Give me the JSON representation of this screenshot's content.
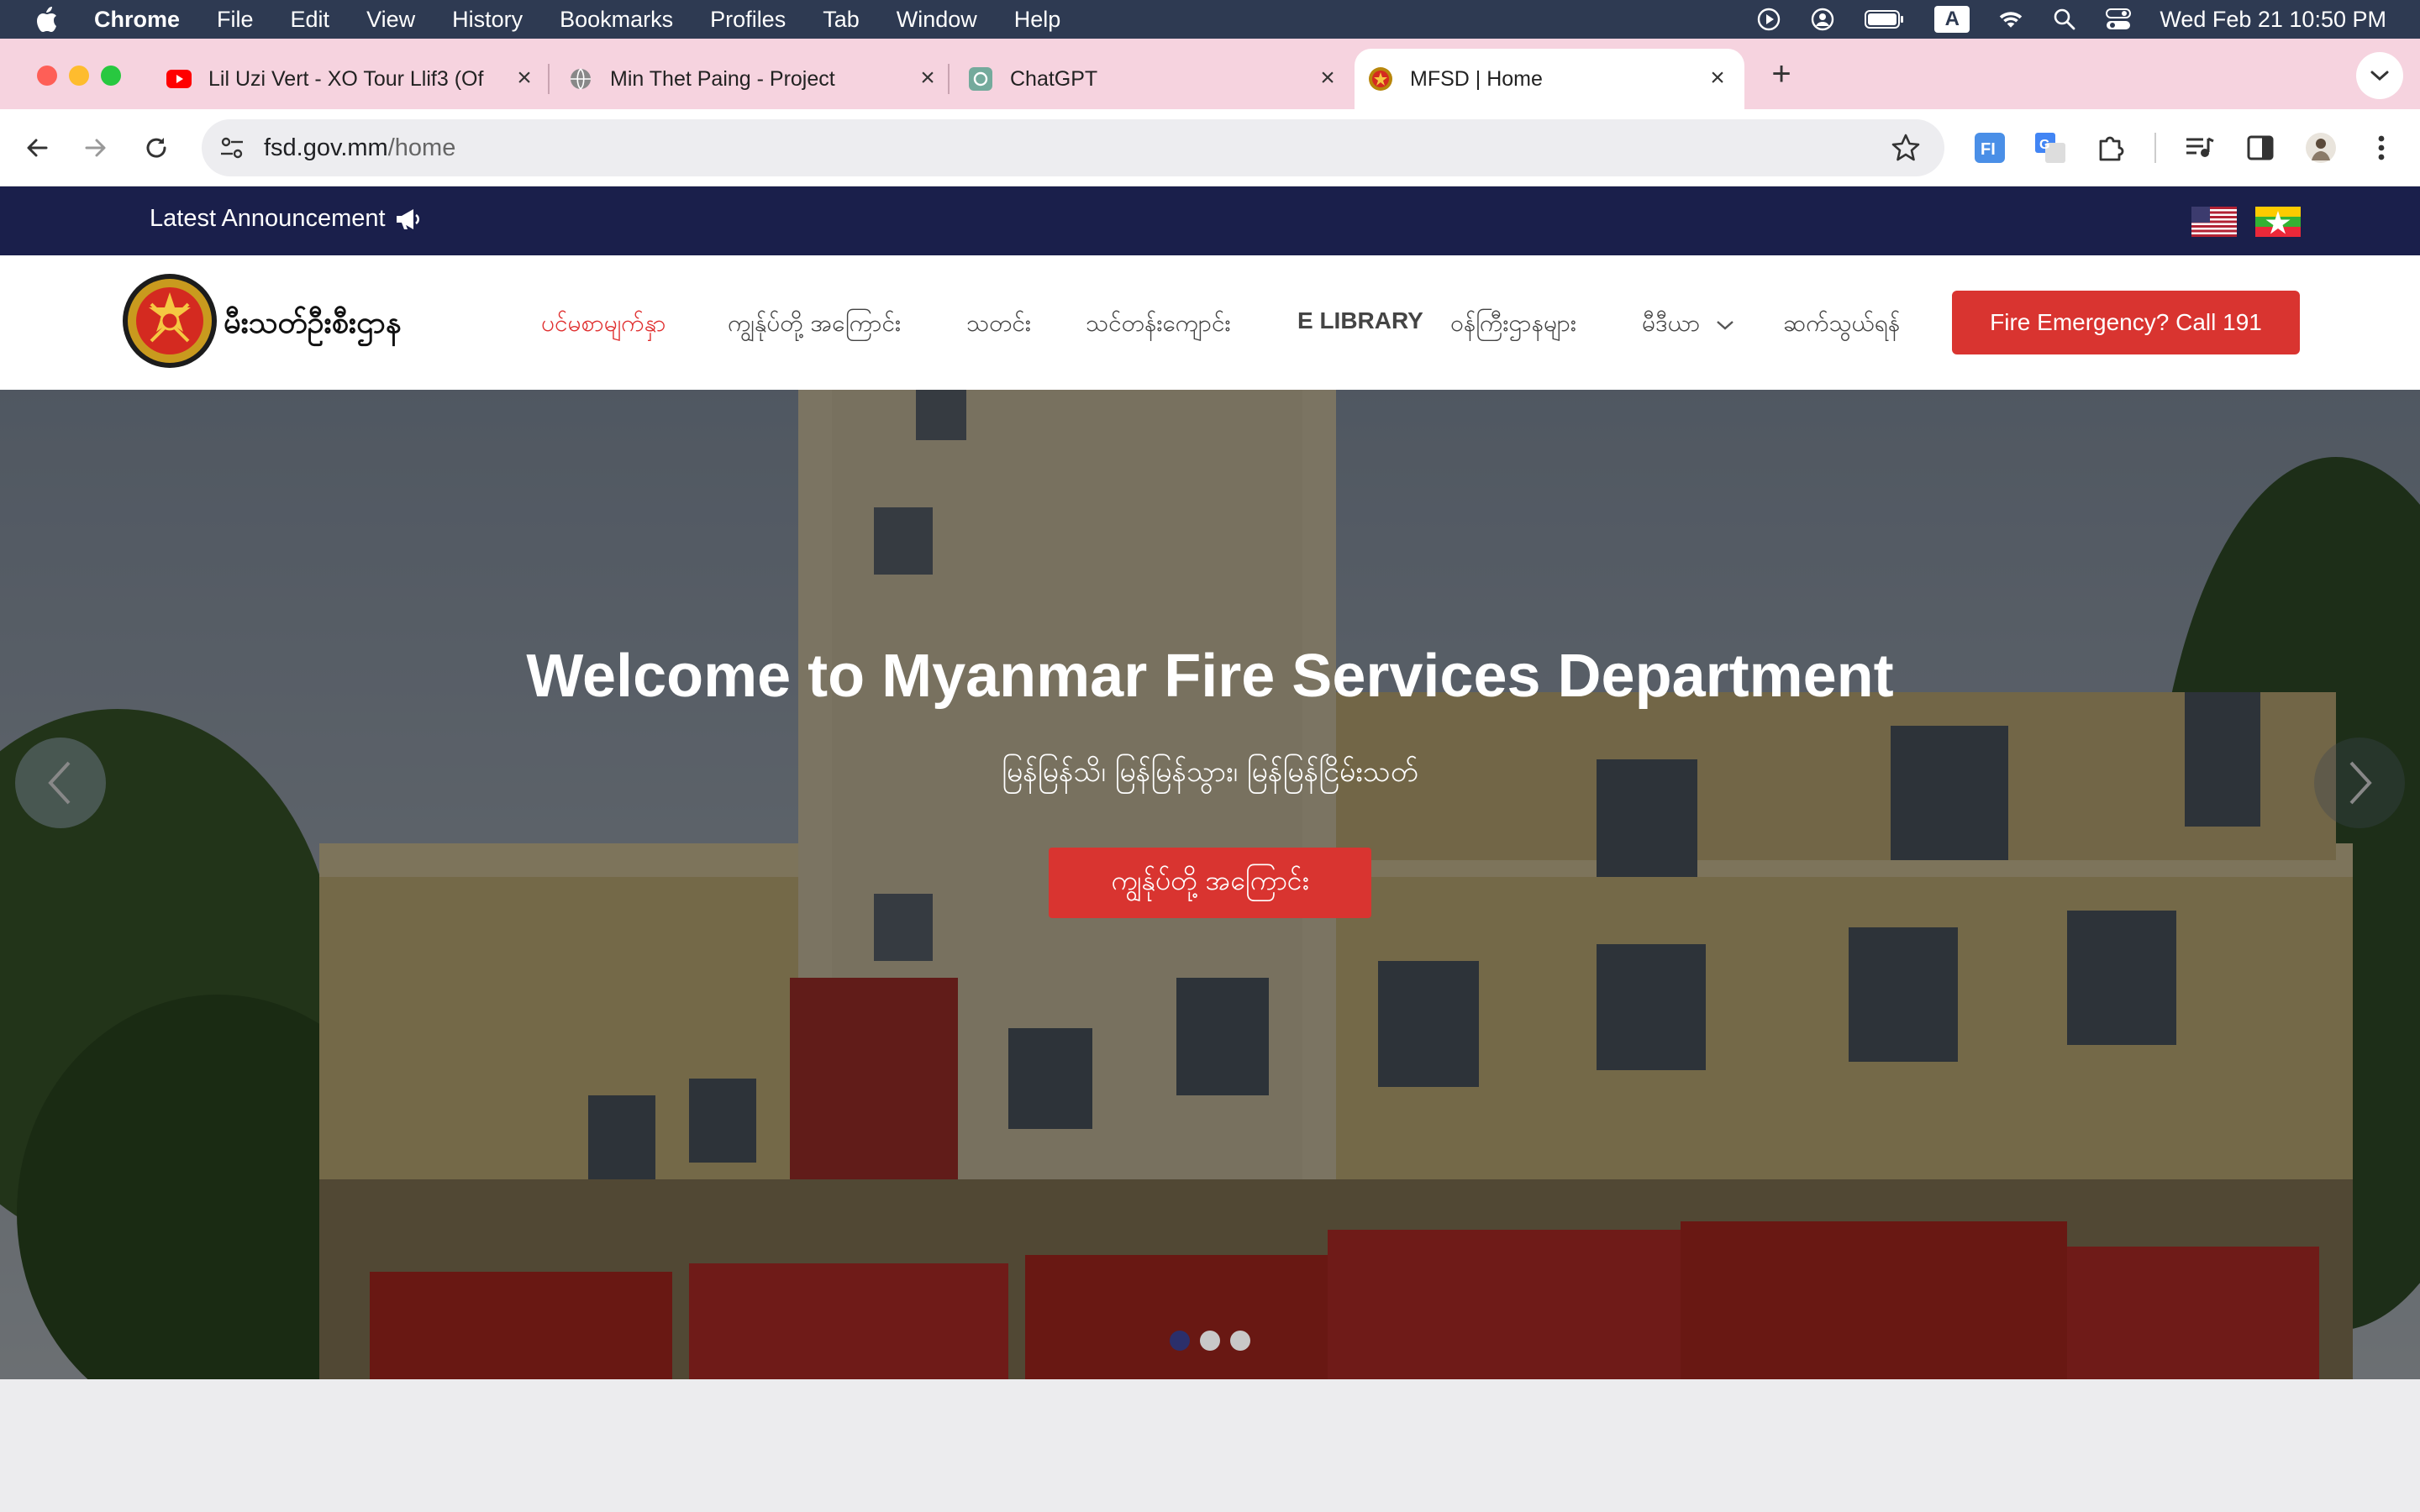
{
  "menubar": {
    "app": "Chrome",
    "items": [
      "File",
      "Edit",
      "View",
      "History",
      "Bookmarks",
      "Profiles",
      "Tab",
      "Window",
      "Help"
    ],
    "input_indicator": "A",
    "clock": "Wed Feb 21  10:50 PM"
  },
  "tabs": [
    {
      "title": "Lil Uzi Vert - XO Tour Llif3 (Of",
      "icon": "youtube-icon"
    },
    {
      "title": "Min Thet Paing - Project",
      "icon": "globe-icon"
    },
    {
      "title": "ChatGPT",
      "icon": "chatgpt-icon"
    },
    {
      "title": "MFSD | Home",
      "icon": "mfsd-icon"
    }
  ],
  "address": {
    "domain": "fsd.gov.mm",
    "path": "/home"
  },
  "site": {
    "announcement": "Latest Announcement",
    "logo_text": "မီးသတ်ဦးစီးဌာန",
    "nav": [
      "ပင်မစာမျက်နှာ",
      "ကျွန်ုပ်တို့ အကြောင်း",
      "သတင်း",
      "သင်တန်းကျောင်း",
      "E LIBRARY",
      "ဝန်ကြီးဌာနများ",
      "မီဒီယာ",
      "ဆက်သွယ်ရန်"
    ],
    "cta": "Fire Emergency? Call 191"
  },
  "hero": {
    "title": "Welcome to Myanmar Fire Services Department",
    "subtitle": "မြန်မြန်သိ၊ မြန်မြန်သွား၊ မြန်မြန်ငြိမ်းသတ်",
    "button": "ကျွန်ုပ်တို့ အကြောင်း",
    "slides": 3,
    "active_slide": 1
  },
  "colors": {
    "accent": "#d93430",
    "announce_bar": "#1a1f4b",
    "tabstrip": "#f6d3df"
  }
}
